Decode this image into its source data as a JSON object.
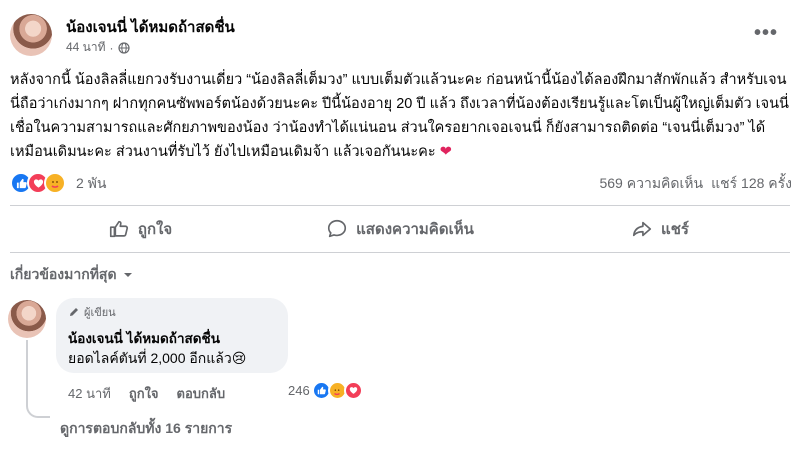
{
  "post": {
    "author": "น้องเจนนี่ ได้หมดถ้าสดชื่น",
    "time": "44 นาที",
    "more_label": "•••",
    "body": "หลังจากนี้ น้องลิลลี่แยกวงรับงานเดี่ยว “น้องลิลลี่เต็มวง” แบบเต็มตัวแล้วนะคะ ก่อนหน้านี้น้องได้ลองฝึกมาสักพักแล้ว สำหรับเจนนี่ถือว่าเก่งมากๆ ฝากทุกคนซัพพอร์ตน้องด้วยนะคะ ปีนี้น้องอายุ 20 ปี แล้ว ถึงเวลาที่น้องต้องเรียนรู้และโตเป็นผู้ใหญ่เต็มตัว เจนนี่เชื่อในความสามารถและศักยภาพของน้อง ว่าน้องทำได้แน่นอน ส่วนใครอยากเจอเจนนี่ ก็ยังสามารถติดต่อ “เจนนี่เต็มวง” ได้เหมือนเดิมนะคะ ส่วนงานที่รับไว้ ยังไปเหมือนเดิมจ้า แล้วเจอกันนะคะ",
    "body_emoji": "❤",
    "reaction_count": "2 พัน",
    "comments_count": "569 ความคิดเห็น",
    "shares_count": "แชร์ 128 ครั้ง"
  },
  "actions": {
    "like": "ถูกใจ",
    "comment": "แสดงความคิดเห็น",
    "share": "แชร์"
  },
  "sort_label": "เกี่ยวข้องมากที่สุด",
  "comment": {
    "badge": "ผู้เขียน",
    "author": "น้องเจนนี่ ได้หมดถ้าสดชื่น",
    "text": "ยอดไลค์ตันที่ 2,000 อีกแล้ว😢",
    "time": "42 นาที",
    "like": "ถูกใจ",
    "reply": "ตอบกลับ",
    "reaction_count": "246"
  },
  "view_replies": "ดูการตอบกลับทั้ง 16 รายการ",
  "icons": [
    "globe-icon",
    "more-icon",
    "like-icon",
    "comment-icon",
    "share-icon",
    "pencil-icon",
    "chevron-down-icon"
  ],
  "colors": {
    "like_blue": "#1877f2",
    "love_red": "#f33e58",
    "care_yellow": "#f7b125",
    "muted": "#65676b"
  }
}
